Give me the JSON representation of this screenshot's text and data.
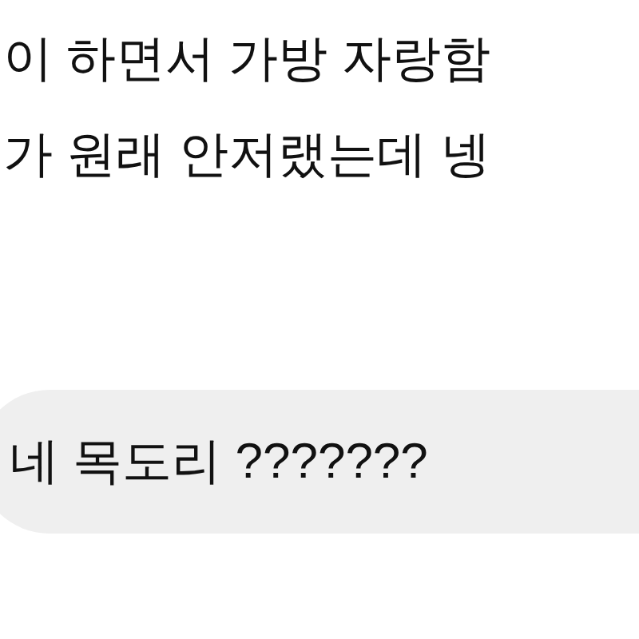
{
  "post_lines": [
    "이 하면서 가방 자랑함",
    "가 원래 안저랬는데 넹"
  ],
  "reply_bubble": {
    "text": "네 목도리 ???????"
  }
}
